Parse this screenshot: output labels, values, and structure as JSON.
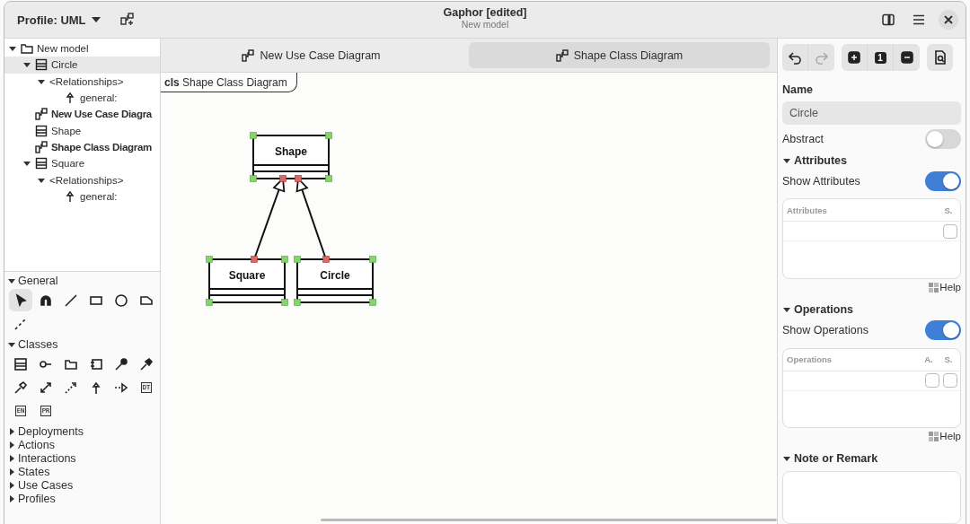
{
  "header": {
    "profile_button": "Profile: UML",
    "title": "Gaphor [edited]",
    "subtitle": "New model"
  },
  "model_tree": [
    {
      "label": "New model",
      "kind": "folder",
      "expanded": true,
      "selected": false,
      "children": [
        {
          "label": "Circle",
          "kind": "class",
          "expanded": true,
          "selected": true,
          "children": [
            {
              "label": "<Relationships>",
              "expanded": true,
              "selected": false,
              "children": [
                {
                  "label": "general:",
                  "kind": "generalization",
                  "selected": false
                }
              ]
            }
          ]
        },
        {
          "label": "New Use Case Diagra",
          "kind": "diagram",
          "selected": false
        },
        {
          "label": "Shape",
          "kind": "class",
          "selected": false
        },
        {
          "label": "Shape Class Diagram",
          "kind": "diagram",
          "selected": false
        },
        {
          "label": "Square",
          "kind": "class",
          "expanded": true,
          "selected": false,
          "children": [
            {
              "label": "<Relationships>",
              "expanded": true,
              "selected": false,
              "children": [
                {
                  "label": "general:",
                  "kind": "generalization",
                  "selected": false
                }
              ]
            }
          ]
        }
      ]
    }
  ],
  "toolbox": [
    {
      "title": "General",
      "expanded": true,
      "tools": [
        {
          "kind": "pointer",
          "selected": true
        },
        {
          "kind": "magnet",
          "selected": false
        },
        {
          "kind": "line",
          "selected": false
        },
        {
          "kind": "rectangle",
          "selected": false
        },
        {
          "kind": "ellipse",
          "selected": false
        },
        {
          "kind": "note",
          "selected": false
        },
        {
          "kind": "dashed-line",
          "selected": false
        }
      ]
    },
    {
      "title": "Classes",
      "expanded": true,
      "tools": [
        {
          "kind": "class",
          "selected": false
        },
        {
          "kind": "lollipop",
          "selected": false
        },
        {
          "kind": "folder",
          "selected": false
        },
        {
          "kind": "component",
          "selected": false
        },
        {
          "kind": "pin",
          "selected": false
        },
        {
          "kind": "filled-arrow",
          "selected": false
        },
        {
          "kind": "hollow-arrow",
          "selected": false
        },
        {
          "kind": "double-arrow",
          "selected": false
        },
        {
          "kind": "dotted-arrow",
          "selected": false
        },
        {
          "kind": "generalization",
          "selected": false
        },
        {
          "kind": "realization",
          "selected": false
        },
        {
          "kind": "label",
          "label": "DT",
          "selected": false
        },
        {
          "kind": "label",
          "label": "EN",
          "selected": false
        },
        {
          "kind": "label",
          "label": "PR",
          "selected": false
        }
      ]
    },
    {
      "title": "Deployments",
      "expanded": false
    },
    {
      "title": "Actions",
      "expanded": false
    },
    {
      "title": "Interactions",
      "expanded": false
    },
    {
      "title": "States",
      "expanded": false
    },
    {
      "title": "Use Cases",
      "expanded": false
    },
    {
      "title": "Profiles",
      "expanded": false
    }
  ],
  "tabs": [
    {
      "label": "New Use Case Diagram",
      "selected": false
    },
    {
      "label": "Shape Class Diagram",
      "selected": true
    }
  ],
  "diagram": {
    "frame_label": "**cls** Shape Class Diagram",
    "classes": [
      {
        "name": "Shape"
      },
      {
        "name": "Square"
      },
      {
        "name": "Circle"
      }
    ],
    "relations": [
      {
        "kind": "generalization"
      },
      {
        "kind": "generalization"
      }
    ]
  },
  "inspector": {
    "toolbar": [
      {
        "kind": "undo",
        "disabled": false
      },
      {
        "kind": "redo",
        "disabled": true
      },
      {
        "kind": "add",
        "disabled": false
      },
      {
        "kind": "badge",
        "label": "1",
        "disabled": false
      },
      {
        "kind": "remove",
        "disabled": false
      },
      {
        "kind": "inspect",
        "disabled": false
      }
    ],
    "name_label": "Name",
    "name_value": "Circle",
    "abstract": {
      "label": "Abstract",
      "on": false
    },
    "sections": [
      {
        "title": "Attributes",
        "expanded": true,
        "toggle": {
          "label": "Show Attributes",
          "on": true
        },
        "columns": [
          "Attributes",
          "S."
        ],
        "rows": [
          {
            "checks": [
              false
            ]
          }
        ],
        "help": "Help"
      },
      {
        "title": "Operations",
        "expanded": true,
        "toggle": {
          "label": "Show Operations",
          "on": true
        },
        "columns": [
          "Operations",
          "A.",
          "S."
        ],
        "rows": [
          {
            "checks": [
              false,
              false
            ]
          }
        ],
        "help": "Help"
      }
    ],
    "note": {
      "title": "Note or Remark",
      "expanded": true
    }
  }
}
